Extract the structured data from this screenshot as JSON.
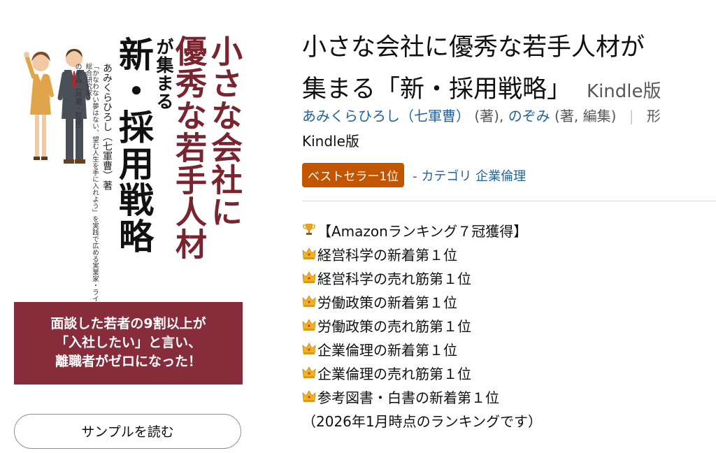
{
  "cover": {
    "title_col1": "小さな会社に",
    "title_col2": "優秀な若手人材",
    "title_suffix": "が集まる",
    "title_main": "新・採用戦略",
    "author": "あみくらひろし（七軍曹）著",
    "quote": "「かなわない夢はない、望む人生を手に入れよう」を実践で広める実業家・ライフワーク総合研究家",
    "coauthor": "のぞみ（共著・監修）",
    "band_line1": "面談した若者の9割以上が",
    "band_line2": "「入社したい」と言い、",
    "band_line3": "離職者がゼロになった！",
    "band_color": "#862c3b"
  },
  "sample_button": {
    "label": "サンプルを読む"
  },
  "product": {
    "title_line1": "小さな会社に優秀な若手人材が",
    "title_line2": "集まる「新・採用戦略」",
    "format": "Kindle版",
    "author1": "あみくらひろし（七軍曹）",
    "author1_role": "(著),",
    "author2": "のぞみ",
    "author2_role": "(著, 編集)",
    "separator": "|",
    "overflow_text": "形",
    "edition": "Kindle版",
    "badge": "ベストセラー1位",
    "category_prefix": "- カテゴリ",
    "category": "企業倫理"
  },
  "description": {
    "headline_icon": "trophy-icon",
    "headline": "【Amazonランキング７冠獲得】",
    "item_icon": "crown-icon",
    "items": [
      "経営科学の新着第１位",
      "経営科学の売れ筋第１位",
      "労働政策の新着第１位",
      "労働政策の売れ筋第１位",
      "企業倫理の新着第１位",
      "企業倫理の売れ筋第１位",
      "参考図書・白書の新着第１位"
    ],
    "note": "（2026年1月時点のランキングです）"
  },
  "colors": {
    "link": "#2162a1",
    "badge": "#c45500",
    "muted": "#565959"
  }
}
